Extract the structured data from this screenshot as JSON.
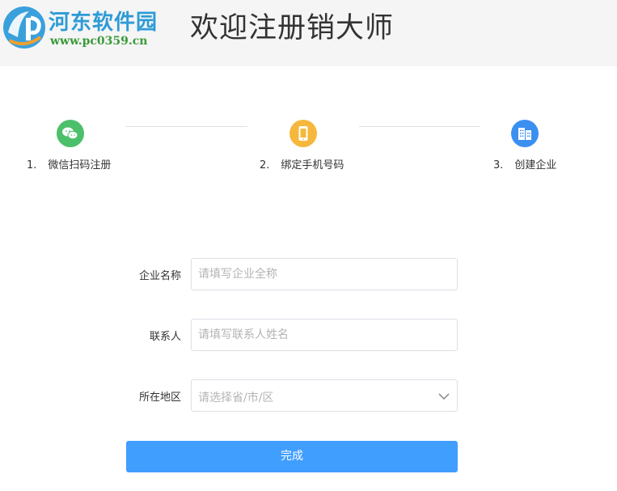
{
  "header": {
    "logo_name": "河东软件园",
    "logo_url": "www.pc0359.cn",
    "title": "欢迎注册销大师"
  },
  "steps": [
    {
      "number": "1.",
      "label": "微信扫码注册",
      "icon": "wechat-icon",
      "color": "#4cbf6b"
    },
    {
      "number": "2.",
      "label": "绑定手机号码",
      "icon": "phone-icon",
      "color": "#f5b83d"
    },
    {
      "number": "3.",
      "label": "创建企业",
      "icon": "building-icon",
      "color": "#3b8ff0"
    }
  ],
  "form": {
    "company": {
      "label": "企业名称",
      "placeholder": "请填写企业全称",
      "value": ""
    },
    "contact": {
      "label": "联系人",
      "placeholder": "请填写联系人姓名",
      "value": ""
    },
    "region": {
      "label": "所在地区",
      "placeholder": "请选择省/市/区"
    },
    "submit_label": "完成"
  },
  "colors": {
    "primary": "#409eff",
    "header_bg": "#f5f5f5"
  }
}
